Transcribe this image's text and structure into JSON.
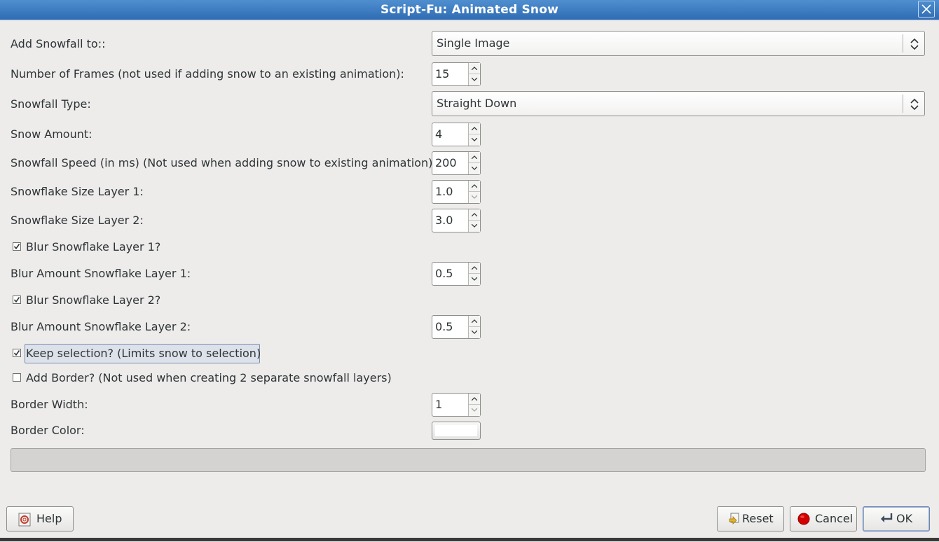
{
  "window": {
    "title": "Script-Fu: Animated Snow",
    "close_icon": "close-icon"
  },
  "form": {
    "add_snowfall_to": {
      "label": "Add Snowfall to::",
      "value": "Single Image"
    },
    "number_of_frames": {
      "label": "Number of Frames (not used if adding snow to an existing animation):",
      "value": "15"
    },
    "snowfall_type": {
      "label": "Snowfall Type:",
      "value": "Straight Down"
    },
    "snow_amount": {
      "label": "Snow Amount:",
      "value": "4"
    },
    "snowfall_speed": {
      "label": "Snowfall Speed (in ms) (Not used when adding snow to existing animation):",
      "value": "200"
    },
    "flake_size_1": {
      "label": "Snowflake Size Layer 1:",
      "value": "1.0"
    },
    "flake_size_2": {
      "label": "Snowflake Size Layer 2:",
      "value": "3.0"
    },
    "blur_layer_1": {
      "label": "Blur Snowflake Layer 1?",
      "checked": true
    },
    "blur_amount_1": {
      "label": "Blur Amount Snowflake Layer 1:",
      "value": "0.5"
    },
    "blur_layer_2": {
      "label": "Blur Snowflake Layer 2?",
      "checked": true
    },
    "blur_amount_2": {
      "label": "Blur Amount Snowflake Layer 2:",
      "value": "0.5"
    },
    "keep_selection": {
      "label": "Keep selection? (Limits snow to selection)",
      "checked": true
    },
    "add_border": {
      "label": "Add Border? (Not used when creating 2 separate snowfall layers)",
      "checked": false
    },
    "border_width": {
      "label": "Border Width:",
      "value": "1"
    },
    "border_color": {
      "label": "Border Color:",
      "value": "#ffffff"
    }
  },
  "progress": {
    "fraction": 0
  },
  "buttons": {
    "help": "Help",
    "reset": "Reset",
    "cancel": "Cancel",
    "ok": "OK"
  },
  "colors": {
    "titlebar": "#3a7cc4",
    "window_bg": "#edeceb",
    "cancel_icon": "#d40000"
  }
}
